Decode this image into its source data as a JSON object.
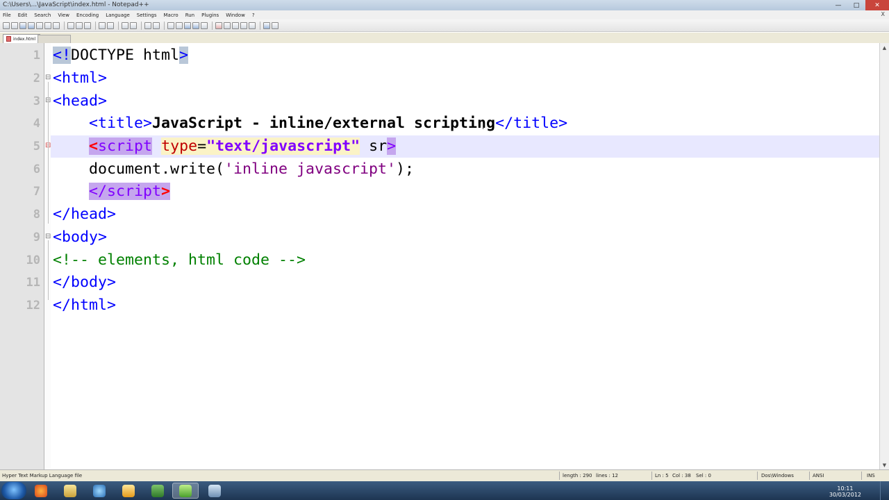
{
  "window": {
    "title": "C:\\Users\\...\\JavaScript\\index.html - Notepad++",
    "controls": [
      "minimize-icon",
      "maximize-icon",
      "close-icon"
    ]
  },
  "menubar": {
    "items": [
      "File",
      "Edit",
      "Search",
      "View",
      "Encoding",
      "Language",
      "Settings",
      "Macro",
      "Run",
      "Plugins",
      "Window",
      "?"
    ],
    "close_glyph": "X"
  },
  "tabs": [
    {
      "label": "index.html",
      "active": true
    }
  ],
  "editor": {
    "line_numbers": [
      "1",
      "2",
      "3",
      "4",
      "5",
      "6",
      "7",
      "8",
      "9",
      "10",
      "11",
      "12"
    ],
    "lines": {
      "l1": {
        "a": "<",
        "b": "!",
        "c": "DOCTYPE html",
        "d": ">"
      },
      "l2": "<html>",
      "l3": "<head>",
      "l4": {
        "indent": "    ",
        "open": "<title>",
        "text": "JavaScript - inline/external scripting",
        "close": "</title>"
      },
      "l5": {
        "indent": "    ",
        "bracket": "<",
        "tag": "script",
        "sp": " ",
        "attr": "type",
        "eq": "=",
        "val": "\"text/javascript\"",
        "sp2": " ",
        "partial": "sr",
        "end": ">"
      },
      "l6": {
        "indent": "    ",
        "obj": "document.write(",
        "str": "'inline javascript'",
        "end": ");"
      },
      "l7": {
        "indent": "    ",
        "tag": "</script",
        "end": ">"
      },
      "l8": "</head>",
      "l9": "<body>",
      "l10": "<!-- elements, html code -->",
      "l11": "</body>",
      "l12": "</html>"
    }
  },
  "statusbar": {
    "language": "Hyper Text Markup Language file",
    "length": "length : 290",
    "lines": "lines : 12",
    "ln": "Ln : 5",
    "col": "Col : 38",
    "sel": "Sel : 0",
    "eol": "Dos\\Windows",
    "encoding": "ANSI",
    "mode": "INS"
  },
  "taskbar": {
    "apps": [
      "firefox-icon",
      "explorer-icon",
      "media-player-icon",
      "outlook-icon",
      "photoshop-icon",
      "notepadpp-icon",
      "app-icon"
    ],
    "time": "10:11",
    "date": "30/03/2012"
  }
}
